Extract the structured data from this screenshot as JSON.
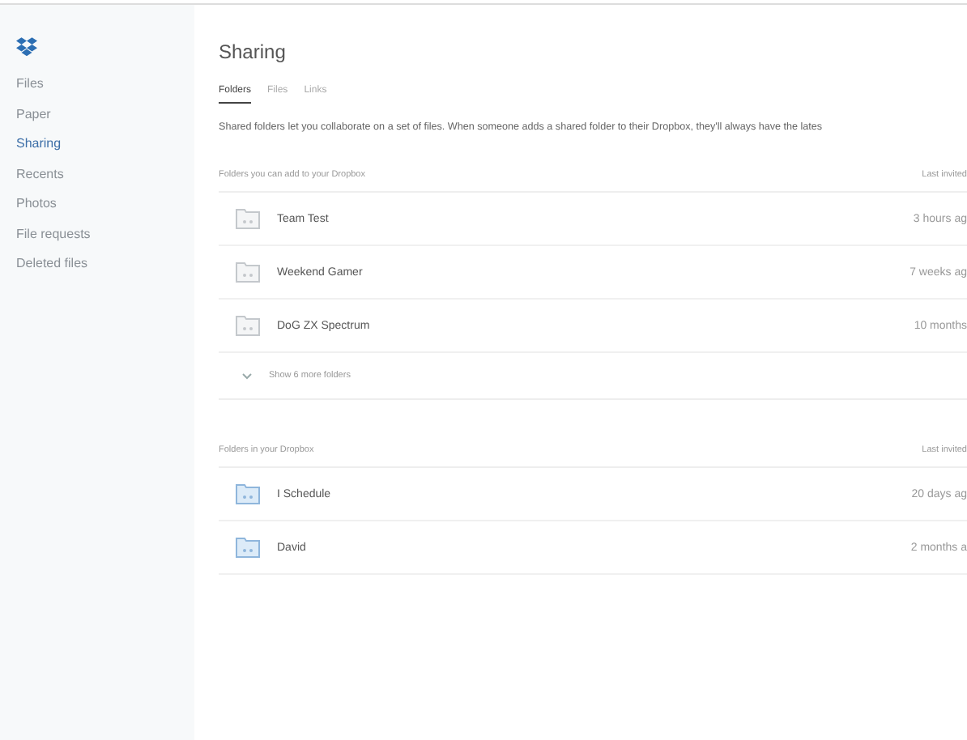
{
  "sidebar": {
    "items": [
      {
        "label": "Files",
        "selected": false
      },
      {
        "label": "Paper",
        "selected": false
      },
      {
        "label": "Sharing",
        "selected": true
      },
      {
        "label": "Recents",
        "selected": false
      },
      {
        "label": "Photos",
        "selected": false
      },
      {
        "label": "File requests",
        "selected": false
      },
      {
        "label": "Deleted files",
        "selected": false
      }
    ]
  },
  "page_title": "Sharing",
  "tabs": [
    {
      "label": "Folders",
      "selected": true
    },
    {
      "label": "Files",
      "selected": false
    },
    {
      "label": "Links",
      "selected": false
    }
  ],
  "description": "Shared folders let you collaborate on a set of files. When someone adds a shared folder to their Dropbox, they'll always have the lates",
  "sections": [
    {
      "heading": "Folders you can add to your Dropbox",
      "column_heading": "Last invited",
      "in_dropbox": false,
      "rows": [
        {
          "name": "Team Test",
          "time": "3 hours ag"
        },
        {
          "name": "Weekend Gamer",
          "time": "7 weeks ag"
        },
        {
          "name": "DoG ZX Spectrum",
          "time": "10 months"
        }
      ],
      "show_more": "Show 6 more folders"
    },
    {
      "heading": "Folders in your Dropbox",
      "column_heading": "Last invited",
      "in_dropbox": true,
      "rows": [
        {
          "name": "I Schedule",
          "time": "20 days ag"
        },
        {
          "name": "David",
          "time": "2 months a"
        }
      ]
    }
  ]
}
